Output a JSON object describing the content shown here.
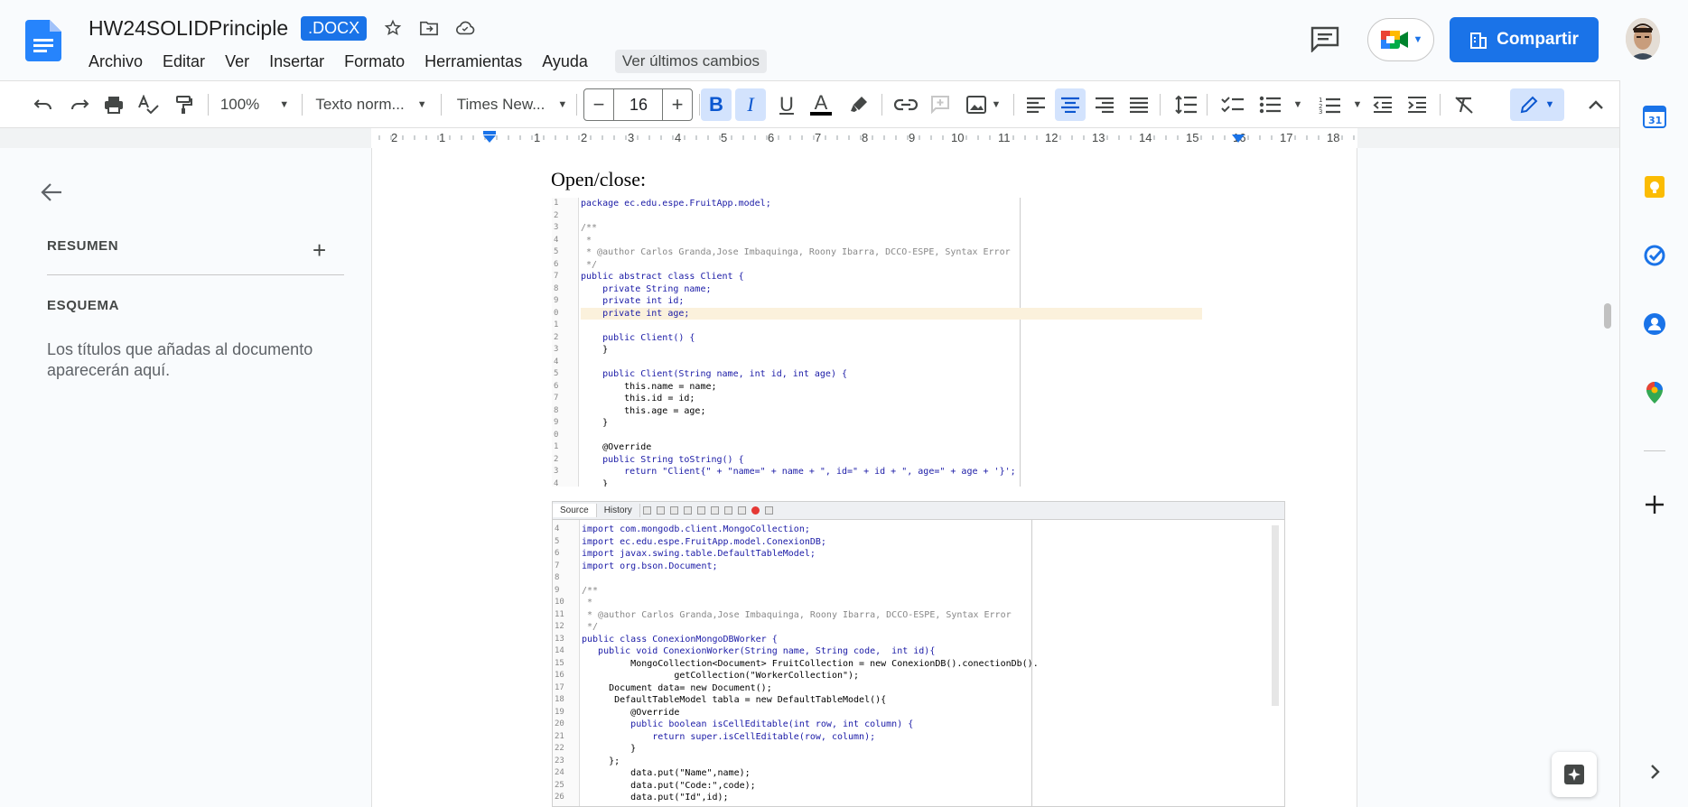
{
  "header": {
    "doc_title": "HW24SOLIDPrinciple",
    "badge": ".DOCX",
    "menu": [
      "Archivo",
      "Editar",
      "Ver",
      "Insertar",
      "Formato",
      "Herramientas",
      "Ayuda"
    ],
    "last_changes": "Ver últimos cambios",
    "share_label": "Compartir"
  },
  "toolbar": {
    "zoom": "100%",
    "style": "Texto norm...",
    "font": "Times New...",
    "font_size": "16",
    "font_minus": "−",
    "font_plus": "+",
    "bold": "B",
    "italic": "I",
    "underline": "U",
    "text_color": "A"
  },
  "ruler": {
    "numbers": [
      "2",
      "1",
      "1",
      "2",
      "3",
      "4",
      "5",
      "6",
      "7",
      "8",
      "9",
      "10",
      "11",
      "12",
      "13",
      "14",
      "15",
      "16",
      "17",
      "18"
    ]
  },
  "outline": {
    "summary_heading": "RESUMEN",
    "summary_add": "+",
    "outline_heading": "ESQUEMA",
    "outline_hint": "Los títulos que añadas al documento aparecerán aquí."
  },
  "page": {
    "heading": "Open/close:",
    "code1": {
      "line_numbers": [
        "1",
        "2",
        "3",
        "4",
        "5",
        "6",
        "7",
        "8",
        "9",
        "0",
        "1",
        "2",
        "3",
        "4",
        "5",
        "6",
        "7",
        "8",
        "9",
        "0",
        "1",
        "2",
        "3",
        "4"
      ],
      "lines": [
        "package ec.edu.espe.FruitApp.model;",
        "",
        "/**",
        " *",
        " * @author Carlos Granda,Jose Imbaquinga, Roony Ibarra, DCCO-ESPE, Syntax Error",
        " */",
        "public abstract class Client {",
        "    private String name;",
        "    private int id;",
        "    private int age;",
        "",
        "    public Client() {",
        "    }",
        "",
        "    public Client(String name, int id, int age) {",
        "        this.name = name;",
        "        this.id = id;",
        "        this.age = age;",
        "    }",
        "",
        "    @Override",
        "    public String toString() {",
        "        return \"Client{\" + \"name=\" + name + \", id=\" + id + \", age=\" + age + '}';",
        "    }"
      ]
    },
    "code2": {
      "tabs": [
        "Source",
        "History"
      ],
      "line_numbers": [
        "4",
        "5",
        "6",
        "7",
        "8",
        "9",
        "10",
        "11",
        "12",
        "13",
        "14",
        "15",
        "16",
        "17",
        "18",
        "19",
        "20",
        "21",
        "22",
        "23",
        "24",
        "25",
        "26"
      ],
      "lines": [
        "import com.mongodb.client.MongoCollection;",
        "import ec.edu.espe.FruitApp.model.ConexionDB;",
        "import javax.swing.table.DefaultTableModel;",
        "import org.bson.Document;",
        "",
        "/**",
        " *",
        " * @author Carlos Granda,Jose Imbaquinga, Roony Ibarra, DCCO-ESPE, Syntax Error",
        " */",
        "public class ConexionMongoDBWorker {",
        "   public void ConexionWorker(String name, String code,  int id){",
        "         MongoCollection<Document> FruitCollection = new ConexionDB().conectionDb().",
        "                 getCollection(\"WorkerCollection\");",
        "     Document data= new Document();",
        "      DefaultTableModel tabla = new DefaultTableModel(){",
        "         @Override",
        "         public boolean isCellEditable(int row, int column) {",
        "             return super.isCellEditable(row, column);",
        "         }",
        "     };",
        "         data.put(\"Name\",name);",
        "         data.put(\"Code:\",code);",
        "         data.put(\"Id\",id);"
      ]
    }
  },
  "colors": {
    "accent": "#1a73e8",
    "toolbar_active": "#d3e3fd",
    "highlight_line": "#fbf1dc"
  }
}
